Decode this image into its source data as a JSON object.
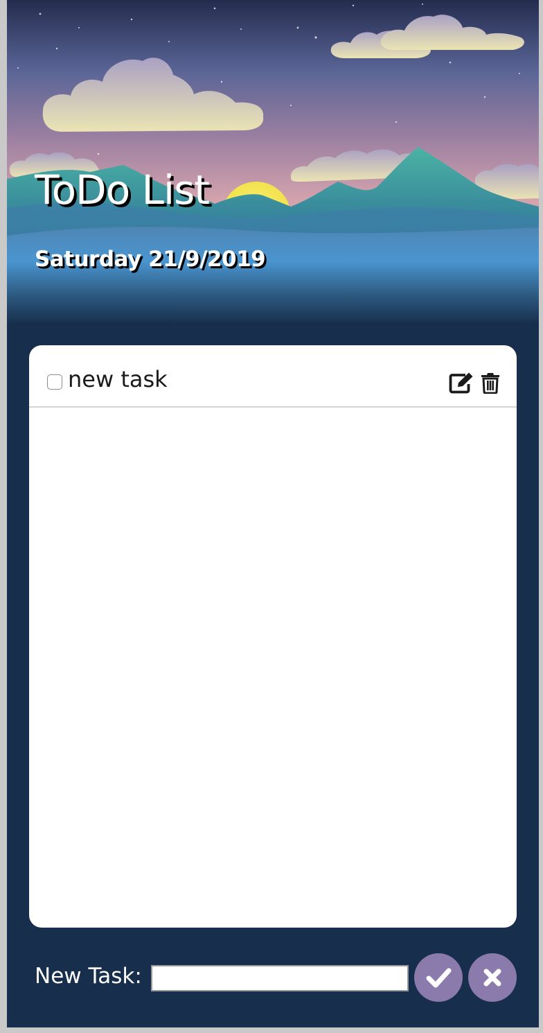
{
  "header": {
    "title": "ToDo List",
    "date": "Saturday 21/9/2019"
  },
  "tasks": [
    {
      "text": "new task",
      "checked": false,
      "icons": [
        "edit-icon",
        "trash-icon"
      ]
    }
  ],
  "footer": {
    "label": "New Task:",
    "input_value": "",
    "confirm_icon": "check-icon",
    "cancel_icon": "close-icon"
  },
  "colors": {
    "app_background": "#172e4c",
    "card_background": "#ffffff",
    "button_background": "#8b7bac",
    "title_text": "#ffffff"
  }
}
